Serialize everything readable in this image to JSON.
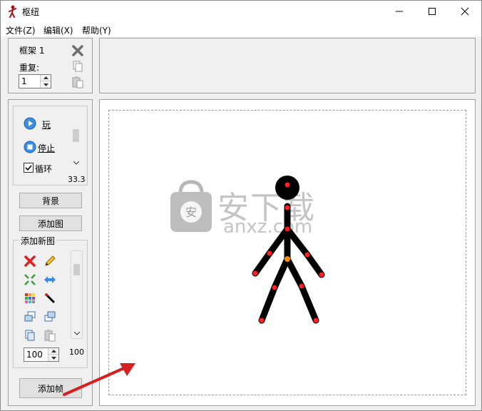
{
  "window": {
    "title": "枢纽"
  },
  "menu": {
    "items": [
      "文件(Z)",
      "编辑(X)",
      "帮助(Y)"
    ]
  },
  "frame_panel": {
    "frame_label": "框架 1",
    "repeat_label": "重复:",
    "repeat_value": "1"
  },
  "playback": {
    "play_label": "玩",
    "stop_label": "停止",
    "loop_label": "循环",
    "loop_checked": true,
    "speed_value": "33.3"
  },
  "buttons": {
    "background": "背景",
    "add_image": "添加图",
    "add_frame": "添加帧"
  },
  "figures_panel": {
    "title": "添加新图",
    "size_value": "100",
    "scale_label": "100"
  },
  "watermark": {
    "text_top": "安下载",
    "text_bottom": "anxz.com"
  },
  "colors": {
    "figure": "#000000",
    "joint": "#ff2020",
    "center_joint": "#ff8c00",
    "arrow": "#d42020"
  }
}
